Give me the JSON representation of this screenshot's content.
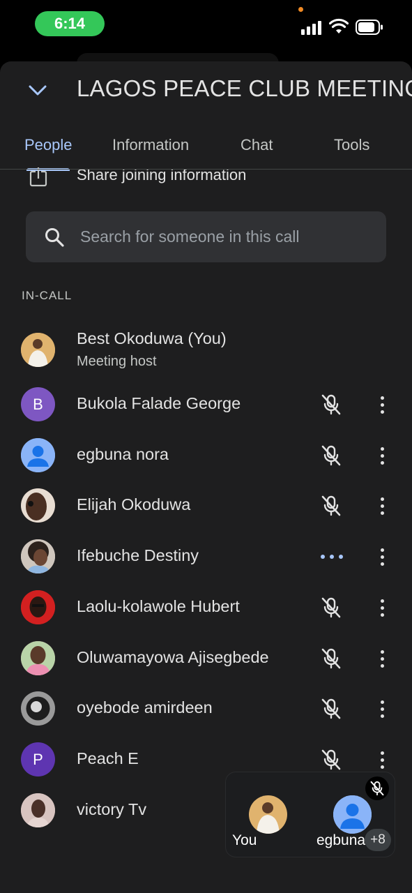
{
  "status_bar": {
    "time": "6:14"
  },
  "header": {
    "title": "LAGOS PEACE CLUB MEETING"
  },
  "tabs": [
    {
      "label": "People",
      "active": true
    },
    {
      "label": "Information",
      "active": false
    },
    {
      "label": "Chat",
      "active": false
    },
    {
      "label": "Tools",
      "active": false
    }
  ],
  "share": {
    "label": "Share joining information"
  },
  "search": {
    "placeholder": "Search for someone in this call",
    "value": ""
  },
  "section": {
    "label": "IN-CALL"
  },
  "participants": [
    {
      "name": "Best Okoduwa (You)",
      "subtitle": "Meeting host",
      "avatar": "photo"
    },
    {
      "name": "Bukola Falade George",
      "initial": "B",
      "avatar_color": "#7e57c2",
      "mic": "muted"
    },
    {
      "name": "egbuna nora",
      "avatar": "default-person",
      "mic": "muted"
    },
    {
      "name": "Elijah Okoduwa",
      "avatar": "photo",
      "mic": "muted"
    },
    {
      "name": "Ifebuche Destiny",
      "avatar": "photo",
      "mic": "speaking"
    },
    {
      "name": "Laolu-kolawole Hubert",
      "avatar": "photo",
      "mic": "muted"
    },
    {
      "name": "Oluwamayowa Ajisegbede",
      "avatar": "photo",
      "mic": "muted"
    },
    {
      "name": "oyebode amirdeen",
      "avatar": "photo",
      "mic": "muted"
    },
    {
      "name": "Peach E",
      "initial": "P",
      "avatar_color": "#5e35b1",
      "mic": "muted"
    },
    {
      "name": "victory Tv",
      "avatar": "photo"
    }
  ],
  "mini_view": {
    "you_label": "You",
    "other_label": "egbuna",
    "more_count": "+8"
  },
  "colors": {
    "accent": "#a8c7fa",
    "sheet_bg": "#1e1e1f",
    "time_pill": "#34c759"
  }
}
